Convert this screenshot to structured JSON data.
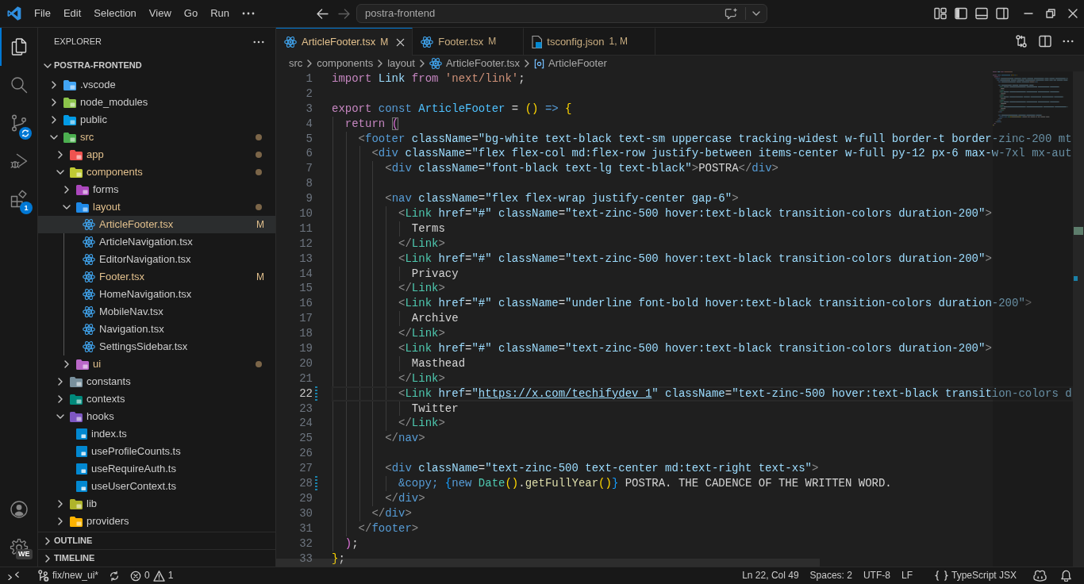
{
  "title_bar": {
    "menu": [
      "File",
      "Edit",
      "Selection",
      "View",
      "Go",
      "Run"
    ],
    "nav_buttons": [
      {
        "kind": "back",
        "disabled": false
      },
      {
        "kind": "forward",
        "disabled": true
      }
    ],
    "command_center": {
      "text": "postra-frontend"
    }
  },
  "activity_bar": {
    "items": [
      {
        "kind": "explorer",
        "selected": true
      },
      {
        "kind": "search",
        "selected": false
      },
      {
        "kind": "source-control",
        "selected": false
      },
      {
        "kind": "run-debug",
        "selected": false
      },
      {
        "kind": "extensions",
        "selected": false,
        "badge": "1"
      }
    ],
    "bottom": [
      {
        "kind": "account"
      },
      {
        "kind": "manage",
        "badge": "WE"
      }
    ]
  },
  "sidebar": {
    "title": "EXPLORER",
    "project": {
      "name": "POSTRA-FRONTEND",
      "expanded": true
    },
    "tree": [
      {
        "name": ".vscode",
        "kind": "folder",
        "color": "#42a5f5",
        "expanded": false,
        "selected": false,
        "modified": false,
        "has_changes": false
      },
      {
        "name": "node_modules",
        "kind": "folder",
        "color": "#8bc34a",
        "expanded": false,
        "selected": false,
        "modified": false,
        "has_changes": false
      },
      {
        "name": "public",
        "kind": "folder",
        "color": "#039be5",
        "expanded": false,
        "selected": false,
        "modified": false,
        "has_changes": false
      },
      {
        "name": "src",
        "kind": "folder",
        "color": "#4caf50",
        "expanded": true,
        "selected": false,
        "modified": true,
        "has_changes": true,
        "children": [
          {
            "name": "app",
            "kind": "folder",
            "color": "#ef5350",
            "expanded": false,
            "selected": false,
            "modified": true,
            "has_changes": true
          },
          {
            "name": "components",
            "kind": "folder",
            "color": "#c0ca33",
            "expanded": true,
            "selected": false,
            "modified": true,
            "has_changes": true,
            "children": [
              {
                "name": "forms",
                "kind": "folder",
                "color": "#ab47bc",
                "expanded": false,
                "selected": false,
                "modified": false,
                "has_changes": false
              },
              {
                "name": "layout",
                "kind": "folder",
                "color": "#1e88e5",
                "expanded": true,
                "selected": false,
                "modified": true,
                "has_changes": true,
                "children": [
                  {
                    "name": "ArticleFooter.tsx",
                    "kind": "tsx",
                    "selected": true,
                    "modified": true,
                    "badge": "M"
                  },
                  {
                    "name": "ArticleNavigation.tsx",
                    "kind": "tsx",
                    "selected": false,
                    "modified": false
                  },
                  {
                    "name": "EditorNavigation.tsx",
                    "kind": "tsx",
                    "selected": false,
                    "modified": false
                  },
                  {
                    "name": "Footer.tsx",
                    "kind": "tsx",
                    "selected": false,
                    "modified": true,
                    "badge": "M"
                  },
                  {
                    "name": "HomeNavigation.tsx",
                    "kind": "tsx",
                    "selected": false,
                    "modified": false
                  },
                  {
                    "name": "MobileNav.tsx",
                    "kind": "tsx",
                    "selected": false,
                    "modified": false
                  },
                  {
                    "name": "Navigation.tsx",
                    "kind": "tsx",
                    "selected": false,
                    "modified": false
                  },
                  {
                    "name": "SettingsSidebar.tsx",
                    "kind": "tsx",
                    "selected": false,
                    "modified": false
                  }
                ]
              },
              {
                "name": "ui",
                "kind": "folder",
                "color": "#ba68c8",
                "expanded": false,
                "selected": false,
                "modified": true,
                "has_changes": true
              }
            ]
          },
          {
            "name": "constants",
            "kind": "folder",
            "color": "#78909c",
            "expanded": false,
            "selected": false,
            "modified": false,
            "has_changes": false
          },
          {
            "name": "contexts",
            "kind": "folder",
            "color": "#00897b",
            "expanded": false,
            "selected": false,
            "modified": false,
            "has_changes": false
          },
          {
            "name": "hooks",
            "kind": "folder",
            "color": "#7e57c2",
            "expanded": true,
            "selected": false,
            "modified": false,
            "has_changes": false,
            "children": [
              {
                "name": "index.ts",
                "kind": "ts",
                "selected": false,
                "modified": false
              },
              {
                "name": "useProfileCounts.ts",
                "kind": "ts",
                "selected": false,
                "modified": false
              },
              {
                "name": "useRequireAuth.ts",
                "kind": "ts",
                "selected": false,
                "modified": false
              },
              {
                "name": "useUserContext.ts",
                "kind": "ts",
                "selected": false,
                "modified": false
              }
            ]
          },
          {
            "name": "lib",
            "kind": "folder",
            "color": "#afb42b",
            "expanded": false,
            "selected": false,
            "modified": false,
            "has_changes": false
          },
          {
            "name": "providers",
            "kind": "folder",
            "color": "#ffb300",
            "expanded": false,
            "selected": false,
            "modified": false,
            "has_changes": false
          }
        ]
      }
    ],
    "sections": [
      {
        "title": "OUTLINE",
        "expanded": false
      },
      {
        "title": "TIMELINE",
        "expanded": false
      }
    ]
  },
  "editor": {
    "tabs": [
      {
        "label": "ArticleFooter.tsx",
        "kind": "tsx",
        "badge": "M",
        "selected": true,
        "modified": true
      },
      {
        "label": "Footer.tsx",
        "kind": "tsx",
        "badge": "M",
        "selected": false,
        "modified": true
      },
      {
        "label": "tsconfig.json",
        "kind": "tsconfig",
        "badge": "1, M",
        "selected": false,
        "modified": true
      }
    ],
    "breadcrumbs": [
      {
        "text": "src",
        "kind": "folder"
      },
      {
        "text": "components",
        "kind": "folder"
      },
      {
        "text": "layout",
        "kind": "folder"
      },
      {
        "text": "ArticleFooter.tsx",
        "kind": "tsx"
      },
      {
        "text": "ArticleFooter",
        "kind": "symbol"
      }
    ],
    "lines": [
      {
        "number": "1",
        "current": false,
        "changed": false,
        "tokens": [
          {
            "kind": "keyword",
            "text": "import "
          },
          {
            "kind": "variable",
            "text": "Link "
          },
          {
            "kind": "keyword",
            "text": "from "
          },
          {
            "kind": "string",
            "text": "'next/link'"
          },
          {
            "kind": "punctuation",
            "text": ";"
          }
        ]
      },
      {
        "number": "2",
        "current": false,
        "changed": false
      },
      {
        "number": "3",
        "current": false,
        "changed": false,
        "tokens": [
          {
            "kind": "keyword",
            "text": "export "
          },
          {
            "kind": "storage",
            "text": "const "
          },
          {
            "kind": "constant",
            "text": "ArticleFooter "
          },
          {
            "kind": "punctuation",
            "text": "= "
          },
          {
            "kind": "bracket-1",
            "text": "() "
          },
          {
            "kind": "storage",
            "text": "=> "
          },
          {
            "kind": "bracket-1",
            "text": "{"
          }
        ]
      },
      {
        "number": "4",
        "current": false,
        "changed": false,
        "tokens": [
          {
            "kind": "keyword",
            "text": "  return "
          },
          {
            "kind": "bracket-match",
            "text": "("
          }
        ]
      },
      {
        "number": "5",
        "current": false,
        "changed": false,
        "tokens": [
          {
            "kind": "tag-bracket",
            "text": "    <"
          },
          {
            "kind": "tag",
            "text": "footer "
          },
          {
            "kind": "attribute",
            "text": "className"
          },
          {
            "kind": "punctuation",
            "text": "="
          },
          {
            "kind": "attribute-value",
            "text": "\"bg-white text-black text-sm uppercase tracking-widest w-full border-t border-zinc-200 mt"
          }
        ]
      },
      {
        "number": "6",
        "current": false,
        "changed": false,
        "tokens": [
          {
            "kind": "tag-bracket",
            "text": "      <"
          },
          {
            "kind": "tag",
            "text": "div "
          },
          {
            "kind": "attribute",
            "text": "className"
          },
          {
            "kind": "punctuation",
            "text": "="
          },
          {
            "kind": "attribute-value",
            "text": "\"flex flex-col md:flex-row justify-between items-center w-full py-12 px-6 max-w-7xl mx-aut"
          }
        ]
      },
      {
        "number": "7",
        "current": false,
        "changed": false,
        "tokens": [
          {
            "kind": "tag-bracket",
            "text": "        <"
          },
          {
            "kind": "tag",
            "text": "div "
          },
          {
            "kind": "attribute",
            "text": "className"
          },
          {
            "kind": "punctuation",
            "text": "="
          },
          {
            "kind": "attribute-value",
            "text": "\"font-black text-lg text-black\""
          },
          {
            "kind": "tag-bracket",
            "text": ">"
          },
          {
            "kind": "text",
            "text": "POSTRA"
          },
          {
            "kind": "tag-bracket",
            "text": "</"
          },
          {
            "kind": "tag",
            "text": "div"
          },
          {
            "kind": "tag-bracket",
            "text": ">"
          }
        ]
      },
      {
        "number": "8",
        "current": false,
        "changed": false
      },
      {
        "number": "9",
        "current": false,
        "changed": false,
        "tokens": [
          {
            "kind": "tag-bracket",
            "text": "        <"
          },
          {
            "kind": "tag",
            "text": "nav "
          },
          {
            "kind": "attribute",
            "text": "className"
          },
          {
            "kind": "punctuation",
            "text": "="
          },
          {
            "kind": "attribute-value",
            "text": "\"flex flex-wrap justify-center gap-6\""
          },
          {
            "kind": "tag-bracket",
            "text": ">"
          }
        ]
      },
      {
        "number": "10",
        "current": false,
        "changed": false,
        "tokens": [
          {
            "kind": "tag-bracket",
            "text": "          <"
          },
          {
            "kind": "component",
            "text": "Link "
          },
          {
            "kind": "attribute",
            "text": "href"
          },
          {
            "kind": "punctuation",
            "text": "="
          },
          {
            "kind": "attribute-value",
            "text": "\"#\" "
          },
          {
            "kind": "attribute",
            "text": "className"
          },
          {
            "kind": "punctuation",
            "text": "="
          },
          {
            "kind": "attribute-value",
            "text": "\"text-zinc-500 hover:text-black transition-colors duration-200\""
          },
          {
            "kind": "tag-bracket",
            "text": ">"
          }
        ]
      },
      {
        "number": "11",
        "current": false,
        "changed": false,
        "tokens": [
          {
            "kind": "text",
            "text": "            Terms"
          }
        ]
      },
      {
        "number": "12",
        "current": false,
        "changed": false,
        "tokens": [
          {
            "kind": "tag-bracket",
            "text": "          </"
          },
          {
            "kind": "component",
            "text": "Link"
          },
          {
            "kind": "tag-bracket",
            "text": ">"
          }
        ]
      },
      {
        "number": "13",
        "current": false,
        "changed": false,
        "tokens": [
          {
            "kind": "tag-bracket",
            "text": "          <"
          },
          {
            "kind": "component",
            "text": "Link "
          },
          {
            "kind": "attribute",
            "text": "href"
          },
          {
            "kind": "punctuation",
            "text": "="
          },
          {
            "kind": "attribute-value",
            "text": "\"#\" "
          },
          {
            "kind": "attribute",
            "text": "className"
          },
          {
            "kind": "punctuation",
            "text": "="
          },
          {
            "kind": "attribute-value",
            "text": "\"text-zinc-500 hover:text-black transition-colors duration-200\""
          },
          {
            "kind": "tag-bracket",
            "text": ">"
          }
        ]
      },
      {
        "number": "14",
        "current": false,
        "changed": false,
        "tokens": [
          {
            "kind": "text",
            "text": "            Privacy"
          }
        ]
      },
      {
        "number": "15",
        "current": false,
        "changed": false,
        "tokens": [
          {
            "kind": "tag-bracket",
            "text": "          </"
          },
          {
            "kind": "component",
            "text": "Link"
          },
          {
            "kind": "tag-bracket",
            "text": ">"
          }
        ]
      },
      {
        "number": "16",
        "current": false,
        "changed": false,
        "tokens": [
          {
            "kind": "tag-bracket",
            "text": "          <"
          },
          {
            "kind": "component",
            "text": "Link "
          },
          {
            "kind": "attribute",
            "text": "href"
          },
          {
            "kind": "punctuation",
            "text": "="
          },
          {
            "kind": "attribute-value",
            "text": "\"#\" "
          },
          {
            "kind": "attribute",
            "text": "className"
          },
          {
            "kind": "punctuation",
            "text": "="
          },
          {
            "kind": "attribute-value",
            "text": "\"underline font-bold hover:text-black transition-colors duration-200\""
          },
          {
            "kind": "tag-bracket",
            "text": ">"
          }
        ]
      },
      {
        "number": "17",
        "current": false,
        "changed": false,
        "tokens": [
          {
            "kind": "text",
            "text": "            Archive"
          }
        ]
      },
      {
        "number": "18",
        "current": false,
        "changed": false,
        "tokens": [
          {
            "kind": "tag-bracket",
            "text": "          </"
          },
          {
            "kind": "component",
            "text": "Link"
          },
          {
            "kind": "tag-bracket",
            "text": ">"
          }
        ]
      },
      {
        "number": "19",
        "current": false,
        "changed": false,
        "tokens": [
          {
            "kind": "tag-bracket",
            "text": "          <"
          },
          {
            "kind": "component",
            "text": "Link "
          },
          {
            "kind": "attribute",
            "text": "href"
          },
          {
            "kind": "punctuation",
            "text": "="
          },
          {
            "kind": "attribute-value",
            "text": "\"#\" "
          },
          {
            "kind": "attribute",
            "text": "className"
          },
          {
            "kind": "punctuation",
            "text": "="
          },
          {
            "kind": "attribute-value",
            "text": "\"text-zinc-500 hover:text-black transition-colors duration-200\""
          },
          {
            "kind": "tag-bracket",
            "text": ">"
          }
        ]
      },
      {
        "number": "20",
        "current": false,
        "changed": false,
        "tokens": [
          {
            "kind": "text",
            "text": "            Masthead"
          }
        ]
      },
      {
        "number": "21",
        "current": false,
        "changed": false,
        "tokens": [
          {
            "kind": "tag-bracket",
            "text": "          </"
          },
          {
            "kind": "component",
            "text": "Link"
          },
          {
            "kind": "tag-bracket",
            "text": ">"
          }
        ]
      },
      {
        "number": "22",
        "current": true,
        "changed": true,
        "tokens": [
          {
            "kind": "tag-bracket",
            "text": "          <"
          },
          {
            "kind": "component",
            "text": "Link "
          },
          {
            "kind": "attribute",
            "text": "href"
          },
          {
            "kind": "punctuation",
            "text": "="
          },
          {
            "kind": "attribute-value",
            "text": "\""
          },
          {
            "kind": "url",
            "text": "https://x.com/techifydev_1"
          },
          {
            "kind": "attribute-value",
            "text": "\" "
          },
          {
            "kind": "attribute",
            "text": "className"
          },
          {
            "kind": "punctuation",
            "text": "="
          },
          {
            "kind": "attribute-value",
            "text": "\"text-zinc-500 hover:text-black transition-colors d"
          }
        ]
      },
      {
        "number": "23",
        "current": false,
        "changed": false,
        "tokens": [
          {
            "kind": "text",
            "text": "            Twitter"
          }
        ]
      },
      {
        "number": "24",
        "current": false,
        "changed": false,
        "tokens": [
          {
            "kind": "tag-bracket",
            "text": "          </"
          },
          {
            "kind": "component",
            "text": "Link"
          },
          {
            "kind": "tag-bracket",
            "text": ">"
          }
        ]
      },
      {
        "number": "25",
        "current": false,
        "changed": false,
        "tokens": [
          {
            "kind": "tag-bracket",
            "text": "        </"
          },
          {
            "kind": "tag",
            "text": "nav"
          },
          {
            "kind": "tag-bracket",
            "text": ">"
          }
        ]
      },
      {
        "number": "26",
        "current": false,
        "changed": false
      },
      {
        "number": "27",
        "current": false,
        "changed": false,
        "tokens": [
          {
            "kind": "tag-bracket",
            "text": "        <"
          },
          {
            "kind": "tag",
            "text": "div "
          },
          {
            "kind": "attribute",
            "text": "className"
          },
          {
            "kind": "punctuation",
            "text": "="
          },
          {
            "kind": "attribute-value",
            "text": "\"text-zinc-500 text-center md:text-right text-xs\""
          },
          {
            "kind": "tag-bracket",
            "text": ">"
          }
        ]
      },
      {
        "number": "28",
        "current": false,
        "changed": true,
        "tokens": [
          {
            "kind": "entity",
            "text": "          &copy; "
          },
          {
            "kind": "bracket-3",
            "text": "{"
          },
          {
            "kind": "storage",
            "text": "new "
          },
          {
            "kind": "class",
            "text": "Date"
          },
          {
            "kind": "bracket-1",
            "text": "()"
          },
          {
            "kind": "punctuation",
            "text": "."
          },
          {
            "kind": "function",
            "text": "getFullYear"
          },
          {
            "kind": "bracket-1",
            "text": "()"
          },
          {
            "kind": "bracket-3",
            "text": "}"
          },
          {
            "kind": "text",
            "text": " POSTRA. THE CADENCE OF THE WRITTEN WORD."
          }
        ]
      },
      {
        "number": "29",
        "current": false,
        "changed": false,
        "tokens": [
          {
            "kind": "tag-bracket",
            "text": "        </"
          },
          {
            "kind": "tag",
            "text": "div"
          },
          {
            "kind": "tag-bracket",
            "text": ">"
          }
        ]
      },
      {
        "number": "30",
        "current": false,
        "changed": false,
        "tokens": [
          {
            "kind": "tag-bracket",
            "text": "      </"
          },
          {
            "kind": "tag",
            "text": "div"
          },
          {
            "kind": "tag-bracket",
            "text": ">"
          }
        ]
      },
      {
        "number": "31",
        "current": false,
        "changed": false,
        "tokens": [
          {
            "kind": "tag-bracket",
            "text": "    </"
          },
          {
            "kind": "tag",
            "text": "footer"
          },
          {
            "kind": "tag-bracket",
            "text": ">"
          }
        ]
      },
      {
        "number": "32",
        "current": false,
        "changed": false,
        "tokens": [
          {
            "kind": "bracket-2",
            "text": "  )"
          },
          {
            "kind": "punctuation",
            "text": ";"
          }
        ]
      },
      {
        "number": "33",
        "current": false,
        "changed": false,
        "tokens": [
          {
            "kind": "bracket-1",
            "text": "}"
          },
          {
            "kind": "punctuation",
            "text": ";"
          }
        ]
      }
    ]
  },
  "status_bar": {
    "branch": "fix/new_ui*",
    "errors": "0",
    "warnings": "1",
    "items": [
      "Ln 22, Col 49",
      "Spaces: 2",
      "UTF-8",
      "LF"
    ],
    "language": "TypeScript JSX"
  }
}
